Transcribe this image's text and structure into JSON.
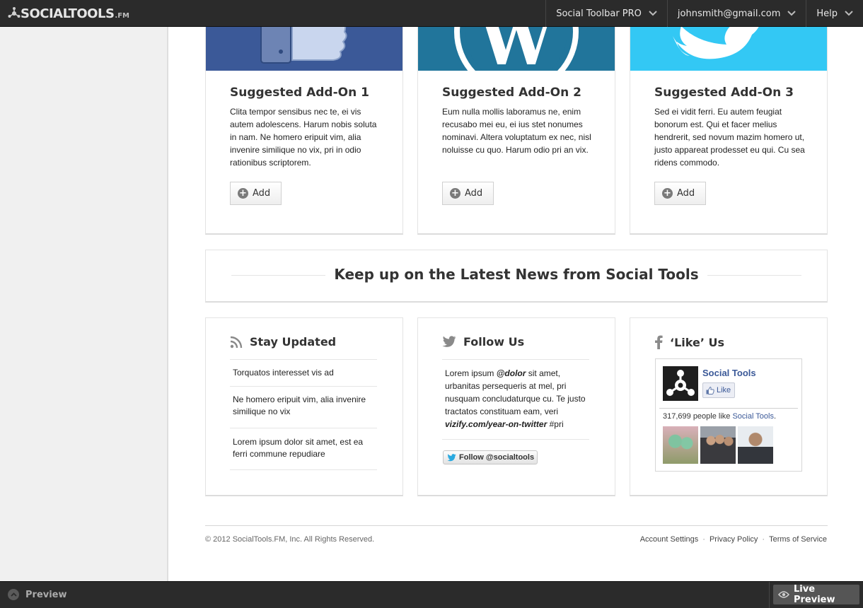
{
  "app": {
    "logo_main": "SOCIALTOOLS",
    "logo_suffix": ".FM"
  },
  "topbar": {
    "items": [
      {
        "label": "Social Toolbar PRO"
      },
      {
        "label": "johnsmith@gmail.com"
      },
      {
        "label": "Help"
      }
    ]
  },
  "addons": [
    {
      "title": "Suggested Add-On 1",
      "description": "Clita tempor sensibus nec te, ei vis autem adolescens. Harum nobis soluta in nam. Ne homero eripuit vim, alia invenire similique no vix, pri in odio rationibus scriptorem.",
      "button": "Add",
      "icon": "facebook-thumb-icon",
      "color": "#3b5998"
    },
    {
      "title": "Suggested Add-On 2",
      "description": "Eum nulla mollis laboramus ne, enim recusabo mei eu, ei ius stet nonumes nominavi. Altera voluptatum ex nec, nisl noluisse cu quo. Harum odio pri an vix.",
      "button": "Add",
      "icon": "wordpress-icon",
      "color": "#21759b"
    },
    {
      "title": "Suggested Add-On 3",
      "description": "Sed ei vidit ferri. Eu autem feugiat bonorum est. Qui et facer melius hendrerit, sed novum mazim homero ut, justo appareat prodesset eu qui. Cu sea ridens commodo.",
      "button": "Add",
      "icon": "twitter-bird-icon",
      "color": "#33c8f4"
    }
  ],
  "news": {
    "title": "Keep up on the Latest News from Social Tools"
  },
  "stay_updated": {
    "title": "Stay Updated",
    "items": [
      "Torquatos interesset vis ad",
      "Ne homero eripuit vim, alia invenire similique no vix",
      "Lorem ipsum dolor sit amet, est ea ferri commune repudiare"
    ]
  },
  "follow": {
    "title": "Follow Us",
    "text_a": "Lorem ipsum ",
    "mention": "@dolor",
    "text_b": " sit amet, urbanitas persequeris at mel, pri nusquam concludaturque cu. Te justo tractatos constituam eam, veri ",
    "link": "vizify.com/year-on-twitter",
    "text_c": " #pri",
    "button": "Follow @socialtools"
  },
  "like": {
    "title": "‘Like’ Us",
    "page_name": "Social Tools",
    "like_button": "Like",
    "count_text": "317,699 people like ",
    "count_link": "Social Tools",
    "count_end": "."
  },
  "footer": {
    "copyright": "© 2012 SocialTools.FM, Inc.  All Rights Reserved.",
    "links": [
      "Account Settings",
      "Privacy Policy",
      "Terms of Service"
    ],
    "separator": "·"
  },
  "bottombar": {
    "preview": "Preview",
    "live_preview": "Live Preview"
  },
  "colors": {
    "topbar": "#2b2b2b",
    "sidebar": "#f0f0f0",
    "facebook": "#3b5998"
  }
}
